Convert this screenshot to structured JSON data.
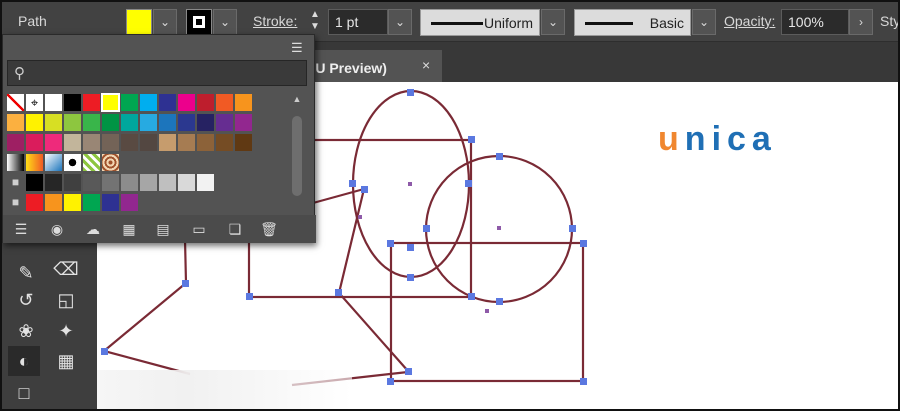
{
  "control_bar": {
    "selection_label": "Path",
    "fill_color": "#ffff00",
    "stroke_label": "Stroke:",
    "stroke_value": "1 pt",
    "variable_width": "Uniform",
    "brush": "Basic",
    "opacity_label": "Opacity:",
    "opacity_value": "100%",
    "style_label": "Sty"
  },
  "document_tab": {
    "title": "PU Preview)",
    "close_glyph": "×"
  },
  "logo": {
    "u": "u",
    "o": "n",
    "rest": "ica"
  },
  "swatches_panel": {
    "menu_icon": "panel-menu-icon",
    "search_placeholder": "",
    "selected_color": "#ffff00",
    "rows": [
      [
        "none",
        "registration",
        "#ffffff",
        "#000000",
        "#ed1c24",
        "#ffff00",
        "#00a651",
        "#00aeef",
        "#2e3192",
        "#ec008c",
        "#be1e2d",
        "#f15a24",
        "#f7941d"
      ],
      [
        "#fbb040",
        "#fff200",
        "#d7df23",
        "#8dc63f",
        "#39b54a",
        "#009444",
        "#00a79d",
        "#27aae1",
        "#1c75bc",
        "#2b388f",
        "#262262",
        "#662d91",
        "#92278f"
      ],
      [
        "#9e1f63",
        "#da1c5c",
        "#ee2a7b",
        "#c2b59b",
        "#998675",
        "#736357",
        "#594a42",
        "#534741",
        "#c69c6d",
        "#a67c52",
        "#8c6239",
        "#754c24",
        "#603913"
      ],
      [
        "grad-white-black",
        "grad-orange",
        "grad-blue",
        "pattern-dots",
        "pattern-leaves",
        "pattern-floral"
      ],
      [
        "folder",
        "#000000",
        "#262626",
        "#404040",
        "#595959",
        "#737373",
        "#8c8c8c",
        "#a6a6a6",
        "#bfbfbf",
        "#d9d9d9",
        "#f2f2f2"
      ],
      [
        "folder",
        "#ed1c24",
        "#f7941d",
        "#fff200",
        "#00a651",
        "#2e3192",
        "#92278f"
      ]
    ]
  },
  "toolbar_icons": [
    "width-tool-icon",
    "eraser-icon",
    "rotate-icon",
    "scale-icon",
    "puppet-warp-icon",
    "pin-icon",
    "shape-builder-icon",
    "perspective-grid-icon",
    "artboard-icon"
  ]
}
